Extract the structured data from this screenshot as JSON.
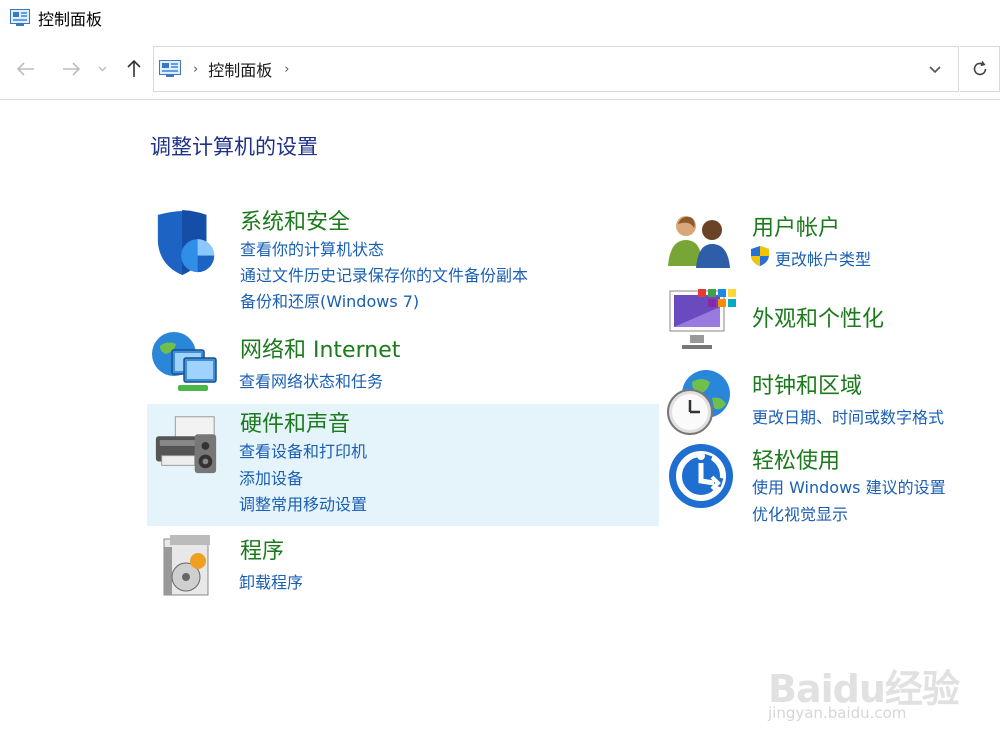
{
  "window": {
    "title": "控制面板"
  },
  "nav": {
    "back_icon": "arrow-left-icon",
    "forward_icon": "arrow-right-icon",
    "up_icon": "arrow-up-icon"
  },
  "address": {
    "crumb": "控制面板"
  },
  "page_title": "调整计算机的设置",
  "categories": {
    "system_security": {
      "heading": "系统和安全",
      "links": [
        "查看你的计算机状态",
        "通过文件历史记录保存你的文件备份副本",
        "备份和还原(Windows 7)"
      ]
    },
    "network": {
      "heading": "网络和 Internet",
      "links": [
        "查看网络状态和任务"
      ]
    },
    "hardware": {
      "heading": "硬件和声音",
      "links": [
        "查看设备和打印机",
        "添加设备",
        "调整常用移动设置"
      ]
    },
    "programs": {
      "heading": "程序",
      "links": [
        "卸载程序"
      ]
    },
    "user_accounts": {
      "heading": "用户帐户",
      "links": [
        "更改帐户类型"
      ]
    },
    "appearance": {
      "heading": "外观和个性化",
      "links": []
    },
    "clock_region": {
      "heading": "时钟和区域",
      "links": [
        "更改日期、时间或数字格式"
      ]
    },
    "ease_of_access": {
      "heading": "轻松使用",
      "links": [
        "使用 Windows 建议的设置",
        "优化视觉显示"
      ]
    }
  },
  "watermark": {
    "brand": "Baidu经验",
    "url": "jingyan.baidu.com"
  },
  "colors": {
    "heading": "#1b7a1b",
    "link": "#1a5fb4",
    "title": "#1e3287",
    "hover": "#e5f3fb"
  }
}
